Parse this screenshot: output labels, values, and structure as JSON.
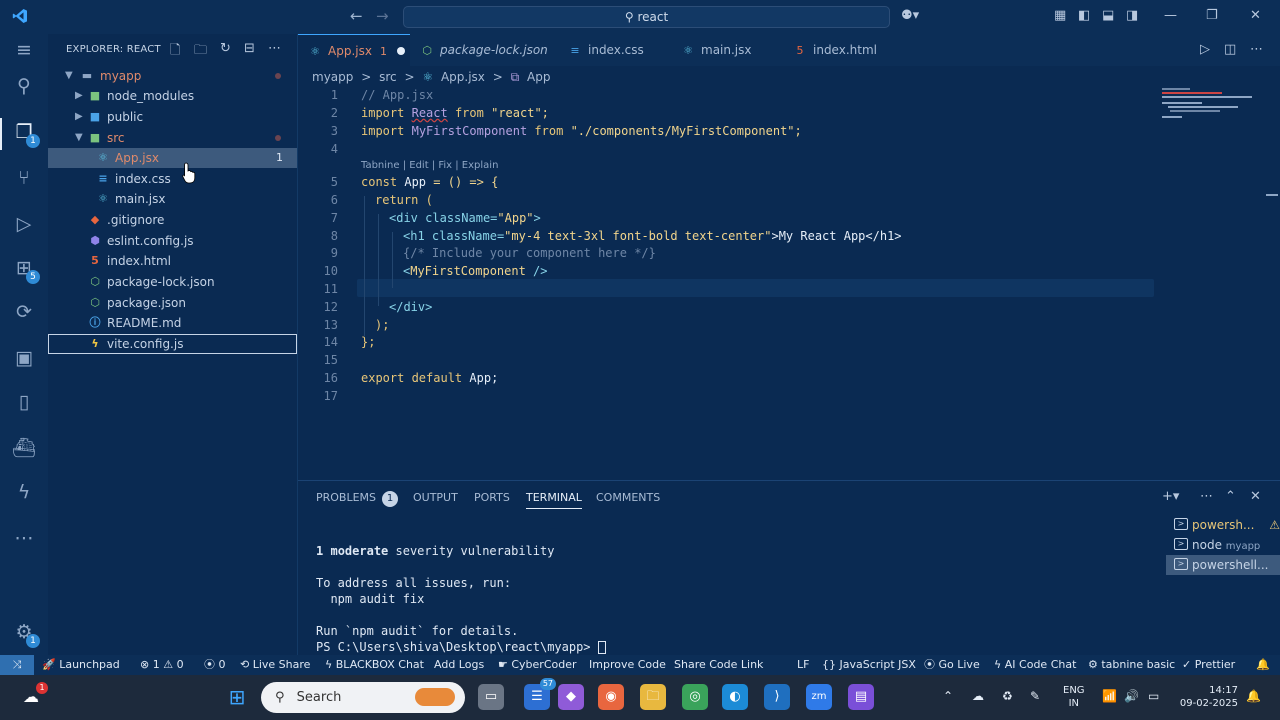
{
  "titlebar": {
    "search_text": "react"
  },
  "activity": {
    "explorer_badge": "1",
    "extensions_badge": "5",
    "settings_badge": "1"
  },
  "sidebar": {
    "title": "EXPLORER: REACT",
    "items": [
      {
        "label": "myapp",
        "icon": "chevron-down-icon"
      },
      {
        "label": "node_modules",
        "icon": "folder-icon"
      },
      {
        "label": "public",
        "icon": "folder-icon"
      },
      {
        "label": "src",
        "icon": "folder-icon"
      },
      {
        "label": "App.jsx",
        "icon": "react-icon",
        "count": "1"
      },
      {
        "label": "index.css",
        "icon": "css-icon"
      },
      {
        "label": "main.jsx",
        "icon": "react-icon"
      },
      {
        "label": ".gitignore",
        "icon": "git-icon"
      },
      {
        "label": "eslint.config.js",
        "icon": "eslint-icon"
      },
      {
        "label": "index.html",
        "icon": "html-icon"
      },
      {
        "label": "package-lock.json",
        "icon": "node-icon"
      },
      {
        "label": "package.json",
        "icon": "node-icon"
      },
      {
        "label": "README.md",
        "icon": "info-icon"
      },
      {
        "label": "vite.config.js",
        "icon": "vite-icon"
      }
    ]
  },
  "tabs": [
    {
      "label": "App.jsx",
      "mark": "1"
    },
    {
      "label": "package-lock.json"
    },
    {
      "label": "index.css"
    },
    {
      "label": "main.jsx"
    },
    {
      "label": "index.html"
    }
  ],
  "breadcrumb": [
    "myapp",
    ">",
    "src",
    ">",
    "App.jsx",
    ">",
    "App"
  ],
  "editor": {
    "line_numbers": [
      "1",
      "2",
      "3",
      "4",
      "5",
      "6",
      "7",
      "8",
      "9",
      "10",
      "11",
      "12",
      "13",
      "14",
      "15",
      "16",
      "17"
    ],
    "codelens": "Tabnine | Edit | Fix | Explain",
    "lines": {
      "l1": "// App.jsx",
      "l2a": "import",
      "l2b": "React",
      "l2c": "from",
      "l2d": "\"react\";",
      "l3a": "import",
      "l3b": "MyFirstComponent",
      "l3c": "from",
      "l3d": "\"./components/MyFirstComponent\";",
      "l5a": "const",
      "l5b": "App",
      "l5c": "= () => {",
      "l6": "return (",
      "l7a": "<div",
      "l7b": "className=",
      "l7c": "\"App\"",
      "l7d": ">",
      "l8a": "<h1",
      "l8b": "className=",
      "l8c": "\"my-4 text-3xl font-bold text-center\"",
      "l8d": ">My React App</h1>",
      "l9": "{/* Include your component here */}",
      "l10a": "<",
      "l10b": "MyFirstComponent",
      "l10c": " />",
      "l12": "</div>",
      "l13": ");",
      "l14": "};",
      "l16a": "export default",
      "l16b": "App;"
    }
  },
  "panel": {
    "tabs": [
      "PROBLEMS",
      "OUTPUT",
      "PORTS",
      "TERMINAL",
      "COMMENTS"
    ],
    "problems_count": "1",
    "terminal": {
      "t1a": "1",
      "t1b": "moderate",
      "t1c": "severity vulnerability",
      "t2": "To address all issues, run:",
      "t3": "  npm audit fix",
      "t4": "Run `npm audit` for details.",
      "t5": "PS C:\\Users\\shiva\\Desktop\\react\\myapp> "
    },
    "terminals": [
      {
        "label": "powersh..."
      },
      {
        "label": "node",
        "sub": "myapp"
      },
      {
        "label": "powershell..."
      }
    ]
  },
  "statusbar": {
    "items": [
      "Launchpad",
      "1",
      "0",
      "0",
      "Live Share",
      "BLACKBOX Chat",
      "Add Logs",
      "CyberCoder",
      "Improve Code",
      "Share Code Link"
    ],
    "right": [
      "LF",
      "{} JavaScript JSX",
      "Go Live",
      "AI Code Chat",
      "tabnine basic",
      "Prettier"
    ]
  },
  "taskbar": {
    "search_placeholder": "Search",
    "lang": "ENG",
    "region": "IN",
    "time": "14:17",
    "date": "09-02-2025",
    "weather_badge": "1",
    "app_badge": "57"
  }
}
